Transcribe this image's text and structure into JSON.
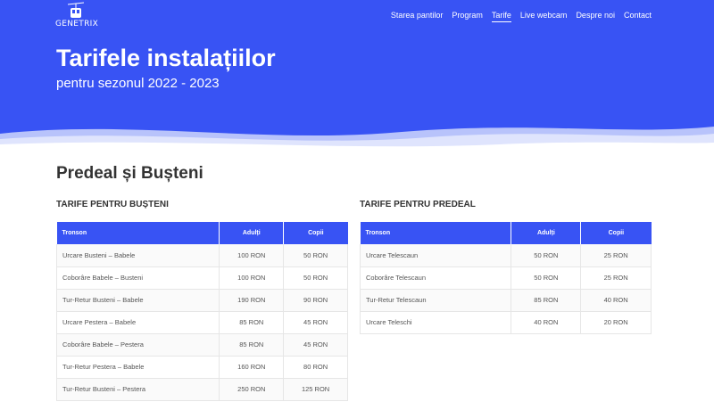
{
  "brand": {
    "logo_text": "GENETRIX"
  },
  "nav": {
    "items": [
      {
        "label": "Starea pantilor"
      },
      {
        "label": "Program"
      },
      {
        "label": "Tarife"
      },
      {
        "label": "Live webcam"
      },
      {
        "label": "Despre noi"
      },
      {
        "label": "Contact"
      }
    ],
    "active": "Tarife"
  },
  "hero": {
    "title": "Tarifele instalațiilor",
    "subtitle": "pentru sezonul 2022 - 2023"
  },
  "section": {
    "title": "Predeal și Bușteni"
  },
  "colors": {
    "accent": "#3853f4"
  },
  "tables": {
    "busteni": {
      "heading": "TARIFE PENTRU BUȘTENI",
      "columns": [
        "Tronson",
        "Adulți",
        "Copii"
      ],
      "rows": [
        [
          "Urcare Busteni – Babele",
          "100 RON",
          "50 RON"
        ],
        [
          "Coborâre Babele – Busteni",
          "100 RON",
          "50 RON"
        ],
        [
          "Tur-Retur Busteni – Babele",
          "190 RON",
          "90 RON"
        ],
        [
          "Urcare Pestera – Babele",
          "85 RON",
          "45 RON"
        ],
        [
          "Coborâre Babele – Pestera",
          "85 RON",
          "45 RON"
        ],
        [
          "Tur-Retur Pestera – Babele",
          "160 RON",
          "80 RON"
        ],
        [
          "Tur-Retur Busteni – Pestera",
          "250 RON",
          "125 RON"
        ]
      ]
    },
    "predeal": {
      "heading": "TARIFE PENTRU PREDEAL",
      "columns": [
        "Tronson",
        "Adulți",
        "Copii"
      ],
      "rows": [
        [
          "Urcare Telescaun",
          "50 RON",
          "25 RON"
        ],
        [
          "Coborâre Telescaun",
          "50 RON",
          "25 RON"
        ],
        [
          "Tur-Retur Telescaun",
          "85 RON",
          "40 RON"
        ],
        [
          "Urcare Teleschi",
          "40 RON",
          "20 RON"
        ]
      ]
    }
  }
}
